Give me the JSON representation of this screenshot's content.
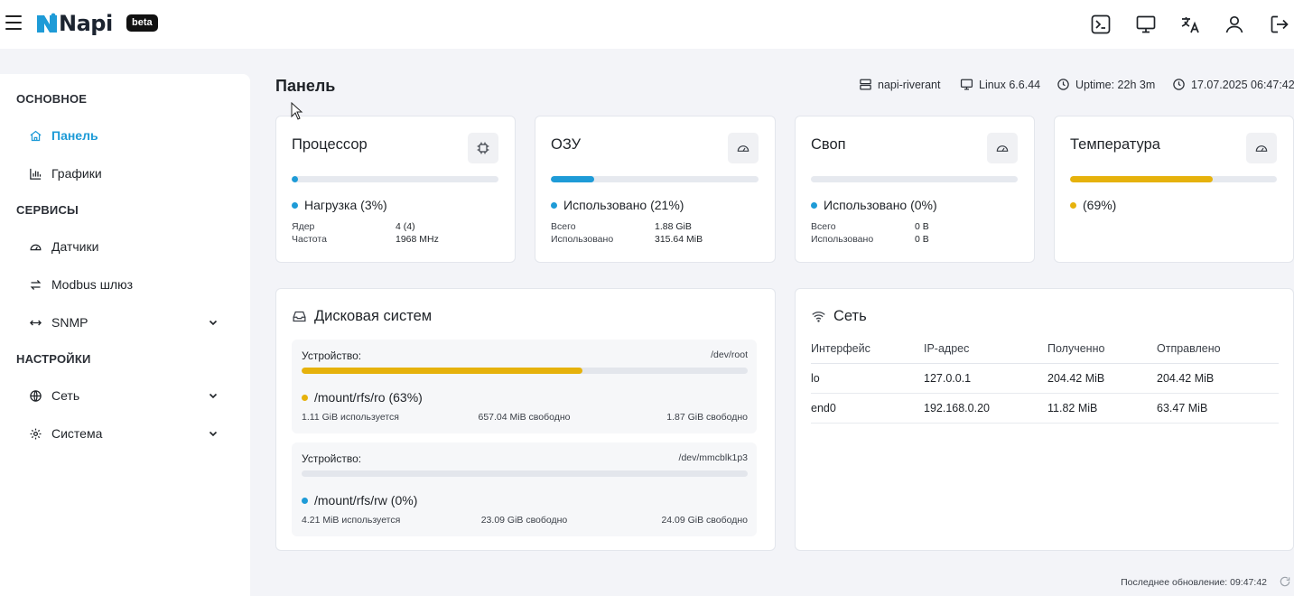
{
  "header": {
    "brand": "Napi",
    "badge": "beta",
    "icons": [
      "terminal-icon",
      "monitor-icon",
      "translate-icon",
      "user-icon",
      "logout-icon"
    ]
  },
  "sidebar": {
    "sections": [
      {
        "title": "ОСНОВНОЕ",
        "items": [
          {
            "label": "Панель",
            "icon": "home-icon",
            "active": true
          },
          {
            "label": "Графики",
            "icon": "bar-chart-icon"
          }
        ]
      },
      {
        "title": "СЕРВИСЫ",
        "items": [
          {
            "label": "Датчики",
            "icon": "gauge-icon"
          },
          {
            "label": "Modbus шлюз",
            "icon": "swap-icon"
          },
          {
            "label": "SNMP",
            "icon": "arrows-horizontal-icon",
            "expandable": true
          }
        ]
      },
      {
        "title": "НАСТРОЙКИ",
        "items": [
          {
            "label": "Сеть",
            "icon": "globe-icon",
            "expandable": true
          },
          {
            "label": "Система",
            "icon": "gear-icon",
            "expandable": true
          }
        ]
      }
    ]
  },
  "main": {
    "title": "Панель",
    "meta": {
      "hostname": "napi-riverant",
      "kernel": "Linux 6.6.44",
      "uptime": "Uptime: 22h 3m",
      "datetime": "17.07.2025 06:47:42"
    },
    "cards": {
      "cpu": {
        "title": "Процессор",
        "legend": "Нагрузка (3%)",
        "percent": 3,
        "color": "#1e9bd7",
        "rows": [
          {
            "k": "Ядер",
            "v": "4 (4)"
          },
          {
            "k": "Частота",
            "v": "1968 MHz"
          }
        ]
      },
      "ram": {
        "title": "ОЗУ",
        "legend": "Использовано (21%)",
        "percent": 21,
        "color": "#1e9bd7",
        "rows": [
          {
            "k": "Всего",
            "v": "1.88 GiB"
          },
          {
            "k": "Использовано",
            "v": "315.64 MiB"
          }
        ]
      },
      "swap": {
        "title": "Своп",
        "legend": "Использовано (0%)",
        "percent": 0,
        "color": "#1e9bd7",
        "rows": [
          {
            "k": "Всего",
            "v": "0 B"
          },
          {
            "k": "Использовано",
            "v": "0 B"
          }
        ]
      },
      "temp": {
        "title": "Температура",
        "legend": "(69%)",
        "percent": 69,
        "color": "#e6b20c"
      }
    },
    "disk": {
      "title": "Дисковая систем",
      "devices": [
        {
          "label": "Устройство:",
          "device": "/dev/root",
          "mount": "/mount/rfs/ro (63%)",
          "percent": 63,
          "color": "#e6b20c",
          "used": "1.11 GiB используется",
          "free": "657.04 MiB свободно",
          "total": "1.87 GiB свободно"
        },
        {
          "label": "Устройство:",
          "device": "/dev/mmcblk1p3",
          "mount": "/mount/rfs/rw (0%)",
          "percent": 0,
          "color": "#1e9bd7",
          "used": "4.21 MiB используется",
          "free": "23.09 GiB свободно",
          "total": "24.09 GiB свободно"
        }
      ]
    },
    "network": {
      "title": "Сеть",
      "columns": [
        "Интерфейс",
        "IP-адрес",
        "Полученно",
        "Отправлено"
      ],
      "rows": [
        [
          "lo",
          "127.0.0.1",
          "204.42 MiB",
          "204.42 MiB"
        ],
        [
          "end0",
          "192.168.0.20",
          "11.82 MiB",
          "63.47 MiB"
        ]
      ]
    },
    "footer": "Последнее обновление: 09:47:42"
  }
}
